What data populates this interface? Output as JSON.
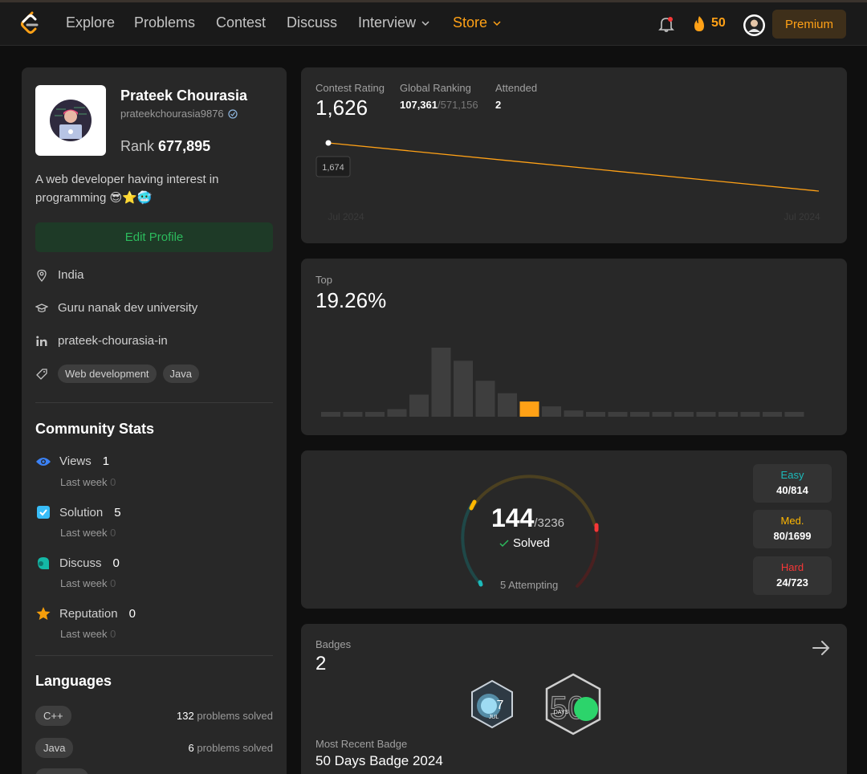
{
  "nav": {
    "items": [
      "Explore",
      "Problems",
      "Contest",
      "Discuss",
      "Interview",
      "Store"
    ],
    "streak": "50",
    "premium": "Premium"
  },
  "profile": {
    "name": "Prateek Chourasia",
    "username": "prateekchourasia9876",
    "rank_label": "Rank",
    "rank_value": "677,895",
    "bio_line1": "A web developer having interest in",
    "bio_line2": "programming 😎⭐🥶",
    "edit_button": "Edit Profile",
    "location": "India",
    "school": "Guru nanak dev university",
    "linkedin": "prateek-chourasia-in",
    "skills": [
      "Web development",
      "Java"
    ]
  },
  "community": {
    "title": "Community Stats",
    "stats": [
      {
        "label": "Views",
        "value": "1",
        "sub": "Last week",
        "delta": "0"
      },
      {
        "label": "Solution",
        "value": "5",
        "sub": "Last week",
        "delta": "0"
      },
      {
        "label": "Discuss",
        "value": "0",
        "sub": "Last week",
        "delta": "0"
      },
      {
        "label": "Reputation",
        "value": "0",
        "sub": "Last week",
        "delta": "0"
      }
    ]
  },
  "languages": {
    "title": "Languages",
    "items": [
      {
        "name": "C++",
        "count": "132",
        "suffix": "problems solved"
      },
      {
        "name": "Java",
        "count": "6",
        "suffix": "problems solved"
      }
    ]
  },
  "contest": {
    "rating_label": "Contest Rating",
    "rating": "1,626",
    "global_label": "Global Ranking",
    "global_rank": "107,361",
    "global_total": "/571,156",
    "attended_label": "Attended",
    "attended": "2",
    "tooltip": "1,674",
    "x_start": "Jul 2024",
    "x_end": "Jul 2024"
  },
  "chart_data": {
    "type": "line",
    "x": [
      "Jul 2024",
      "Jul 2024"
    ],
    "series": [
      {
        "values": [
          1674,
          1626
        ]
      }
    ],
    "annotations": [
      "1,674"
    ]
  },
  "top": {
    "label": "Top",
    "value": "19.26%",
    "bars": [
      0.06,
      0.06,
      0.06,
      0.11,
      0.32,
      1.0,
      0.81,
      0.52,
      0.34,
      0.22,
      0.15,
      0.09,
      0.07,
      0.06,
      0.06,
      0.06,
      0.06,
      0.06,
      0.06,
      0.06,
      0.06,
      0.06
    ],
    "highlight_index": 9
  },
  "solved": {
    "count": "144",
    "total": "/3236",
    "label": "Solved",
    "attempting": "5 Attempting",
    "difficulties": [
      {
        "name": "Easy",
        "count": "40/814",
        "color": "#1cbaba"
      },
      {
        "name": "Med.",
        "count": "80/1699",
        "color": "#ffb700"
      },
      {
        "name": "Hard",
        "count": "24/723",
        "color": "#f63737"
      }
    ]
  },
  "badges": {
    "label": "Badges",
    "count": "2",
    "badge1_text": "7",
    "badge1_sub": "JUL",
    "badge2_text": "50",
    "badge2_sub": "DAYS",
    "recent_label": "Most Recent Badge",
    "recent_name": "50 Days Badge 2024"
  },
  "colors": {
    "accent": "#ffa116",
    "green": "#2cbb5d"
  }
}
